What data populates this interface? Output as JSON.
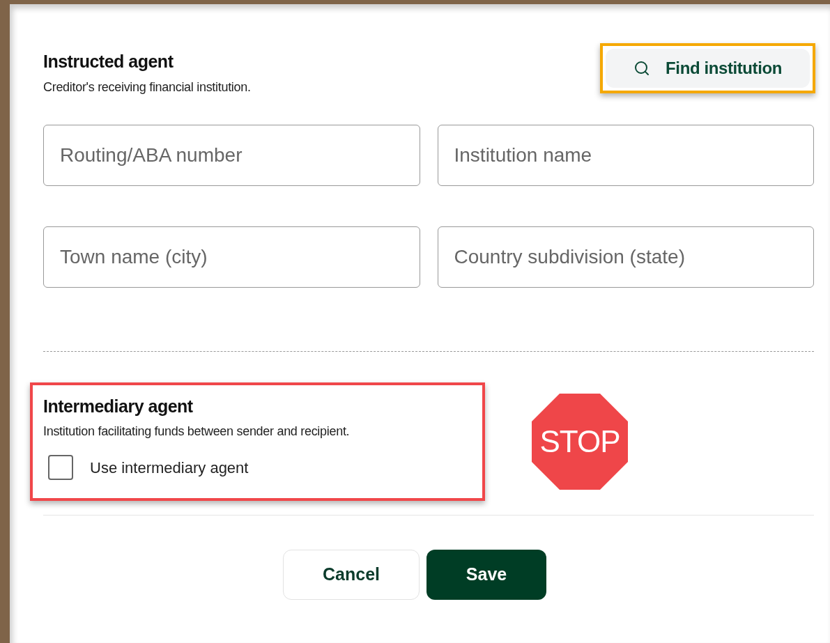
{
  "instructed_agent": {
    "title": "Instructed agent",
    "description": "Creditor's receiving financial institution.",
    "find_button": "Find institution",
    "fields": [
      {
        "placeholder": "Routing/ABA number"
      },
      {
        "placeholder": "Institution name"
      },
      {
        "placeholder": "Town name (city)"
      },
      {
        "placeholder": "Country subdivision (state)"
      }
    ]
  },
  "intermediary_agent": {
    "title": "Intermediary agent",
    "description": "Institution facilitating funds between sender and recipient.",
    "checkbox": {
      "label": "Use intermediary agent",
      "checked": false
    }
  },
  "stop_sign": {
    "text": "STOP"
  },
  "buttons": [
    {
      "label": "Cancel",
      "kind": "secondary"
    },
    {
      "label": "Save",
      "kind": "primary"
    }
  ]
}
